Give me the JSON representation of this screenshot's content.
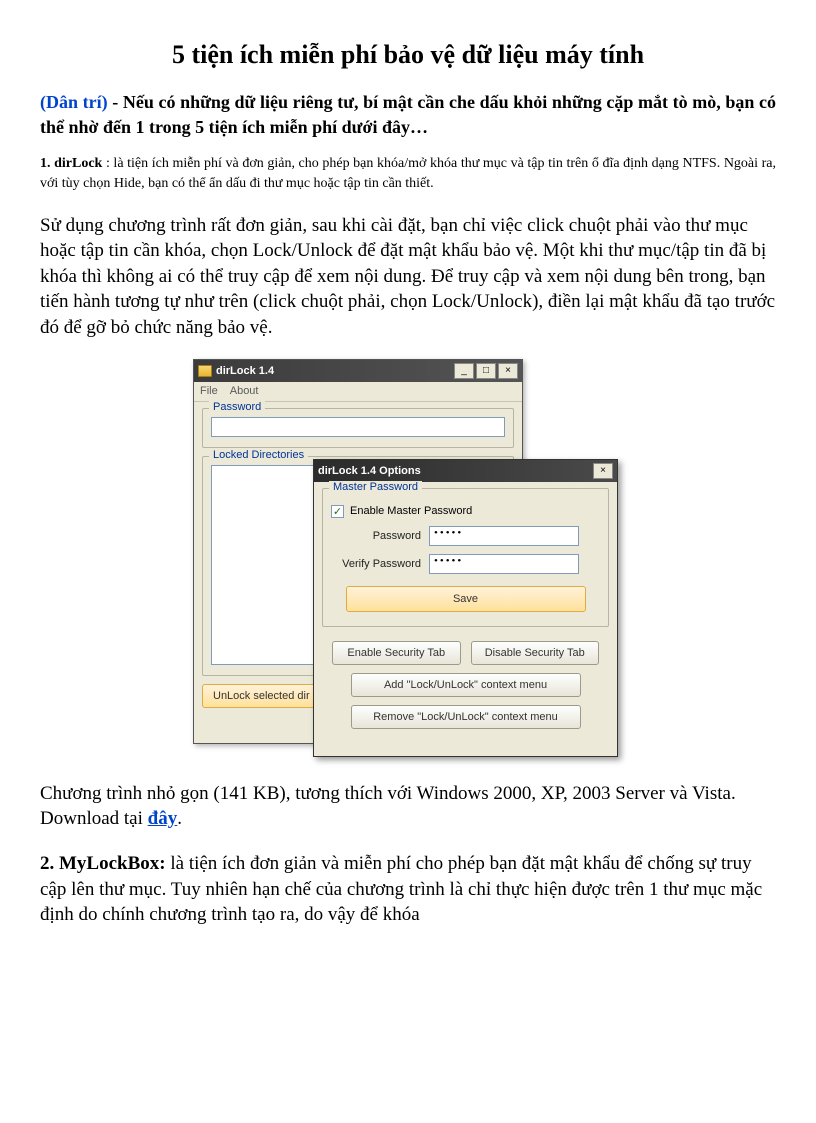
{
  "title": "5 tiện ích miễn phí bảo vệ dữ liệu máy tính",
  "intro_lead": "(Dân trí)",
  "intro_rest": " - Nếu có những dữ liệu riêng tư, bí mật cần che dấu khỏi những cặp mắt tò mò, bạn có thể nhờ đến 1 trong 5 tiện ích miễn phí dưới đây…",
  "item1_label": "1. dirLock",
  "item1_text": " : là tiện ích miễn phí và đơn giản, cho phép bạn khóa/mở khóa thư mục và tập tin trên ổ đĩa định dạng NTFS. Ngoài ra, với tùy chọn Hide, bạn có thể ẩn dấu đi thư mục hoặc tập tin cần thiết.",
  "para1": "Sử dụng chương trình rất đơn giản, sau khi cài đặt, bạn chỉ việc click chuột phải vào thư mục hoặc tập tin cần khóa, chọn Lock/Unlock để đặt mật khẩu bảo vệ. Một khi thư mục/tập tin đã bị khóa thì không ai có thể truy cập để xem nội dung. Để truy cập và xem nội dung bên trong, bạn tiến hành tương tự như trên (click chuột phải, chọn Lock/Unlock), điền lại mật khẩu đã tạo trước đó để gỡ bỏ chức năng bảo vệ.",
  "para2_a": "Chương trình nhỏ gọn (141 KB), tương thích với Windows 2000, XP, 2003 Server và Vista. Download tại ",
  "para2_link": "đây",
  "para2_b": ".",
  "item2_label": "2. MyLockBox:",
  "item2_text": " là tiện ích đơn giản và miễn phí cho phép bạn đặt mật khẩu để chống sự truy cập lên thư mục. Tuy nhiên hạn chế của chương trình là chỉ thực hiện được trên 1 thư mục mặc định do chính chương trình tạo ra, do vậy để khóa",
  "app": {
    "main_title": "dirLock 1.4",
    "menu": {
      "file": "File",
      "about": "About"
    },
    "password_group": "Password",
    "locked_group": "Locked Directories",
    "unlock_btn": "UnLock selected dir",
    "opt_title": "dirLock 1.4 Options",
    "master_group": "Master Password",
    "enable_master": "Enable Master Password",
    "password_lbl": "Password",
    "verify_lbl": "Verify Password",
    "pw_value": "•••••",
    "vpw_value": "•••••",
    "save": "Save",
    "enable_tab": "Enable Security Tab",
    "disable_tab": "Disable Security Tab",
    "add_ctx": "Add \"Lock/UnLock\" context menu",
    "remove_ctx": "Remove \"Lock/UnLock\" context menu",
    "min": "_",
    "max": "□",
    "close": "×"
  }
}
